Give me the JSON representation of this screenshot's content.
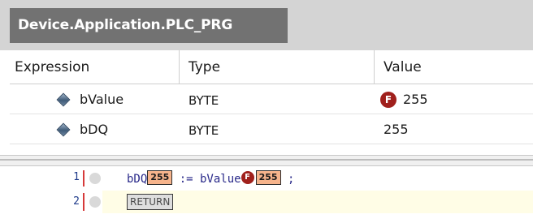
{
  "panel": {
    "tab_title": "Device.Application.PLC_PRG",
    "columns": {
      "expression": "Expression",
      "type": "Type",
      "value": "Value"
    },
    "rows": [
      {
        "name": "bValue",
        "type": "BYTE",
        "value": "255",
        "forced": true,
        "badge": "F"
      },
      {
        "name": "bDQ",
        "type": "BYTE",
        "value": "255",
        "forced": false
      }
    ]
  },
  "editor": {
    "lines": [
      {
        "number": "1",
        "var1": "bDQ",
        "var1_value": "255",
        "assign": " := ",
        "var2": "bValue",
        "var2_badge": "F",
        "var2_value": "255",
        "terminator": " ;"
      },
      {
        "number": "2",
        "keyword": "RETURN"
      }
    ]
  },
  "colors": {
    "tab_bg": "#727272",
    "forced_badge": "#a0201c",
    "inline_value_bg": "#f6b48c",
    "current_line_bg": "#fffde6",
    "line_marker": "#d63a3a"
  },
  "icons": {
    "variable": "variable-diamond-icon",
    "forced": "forced-f-icon",
    "breakpoint": "breakpoint-dot-icon"
  }
}
